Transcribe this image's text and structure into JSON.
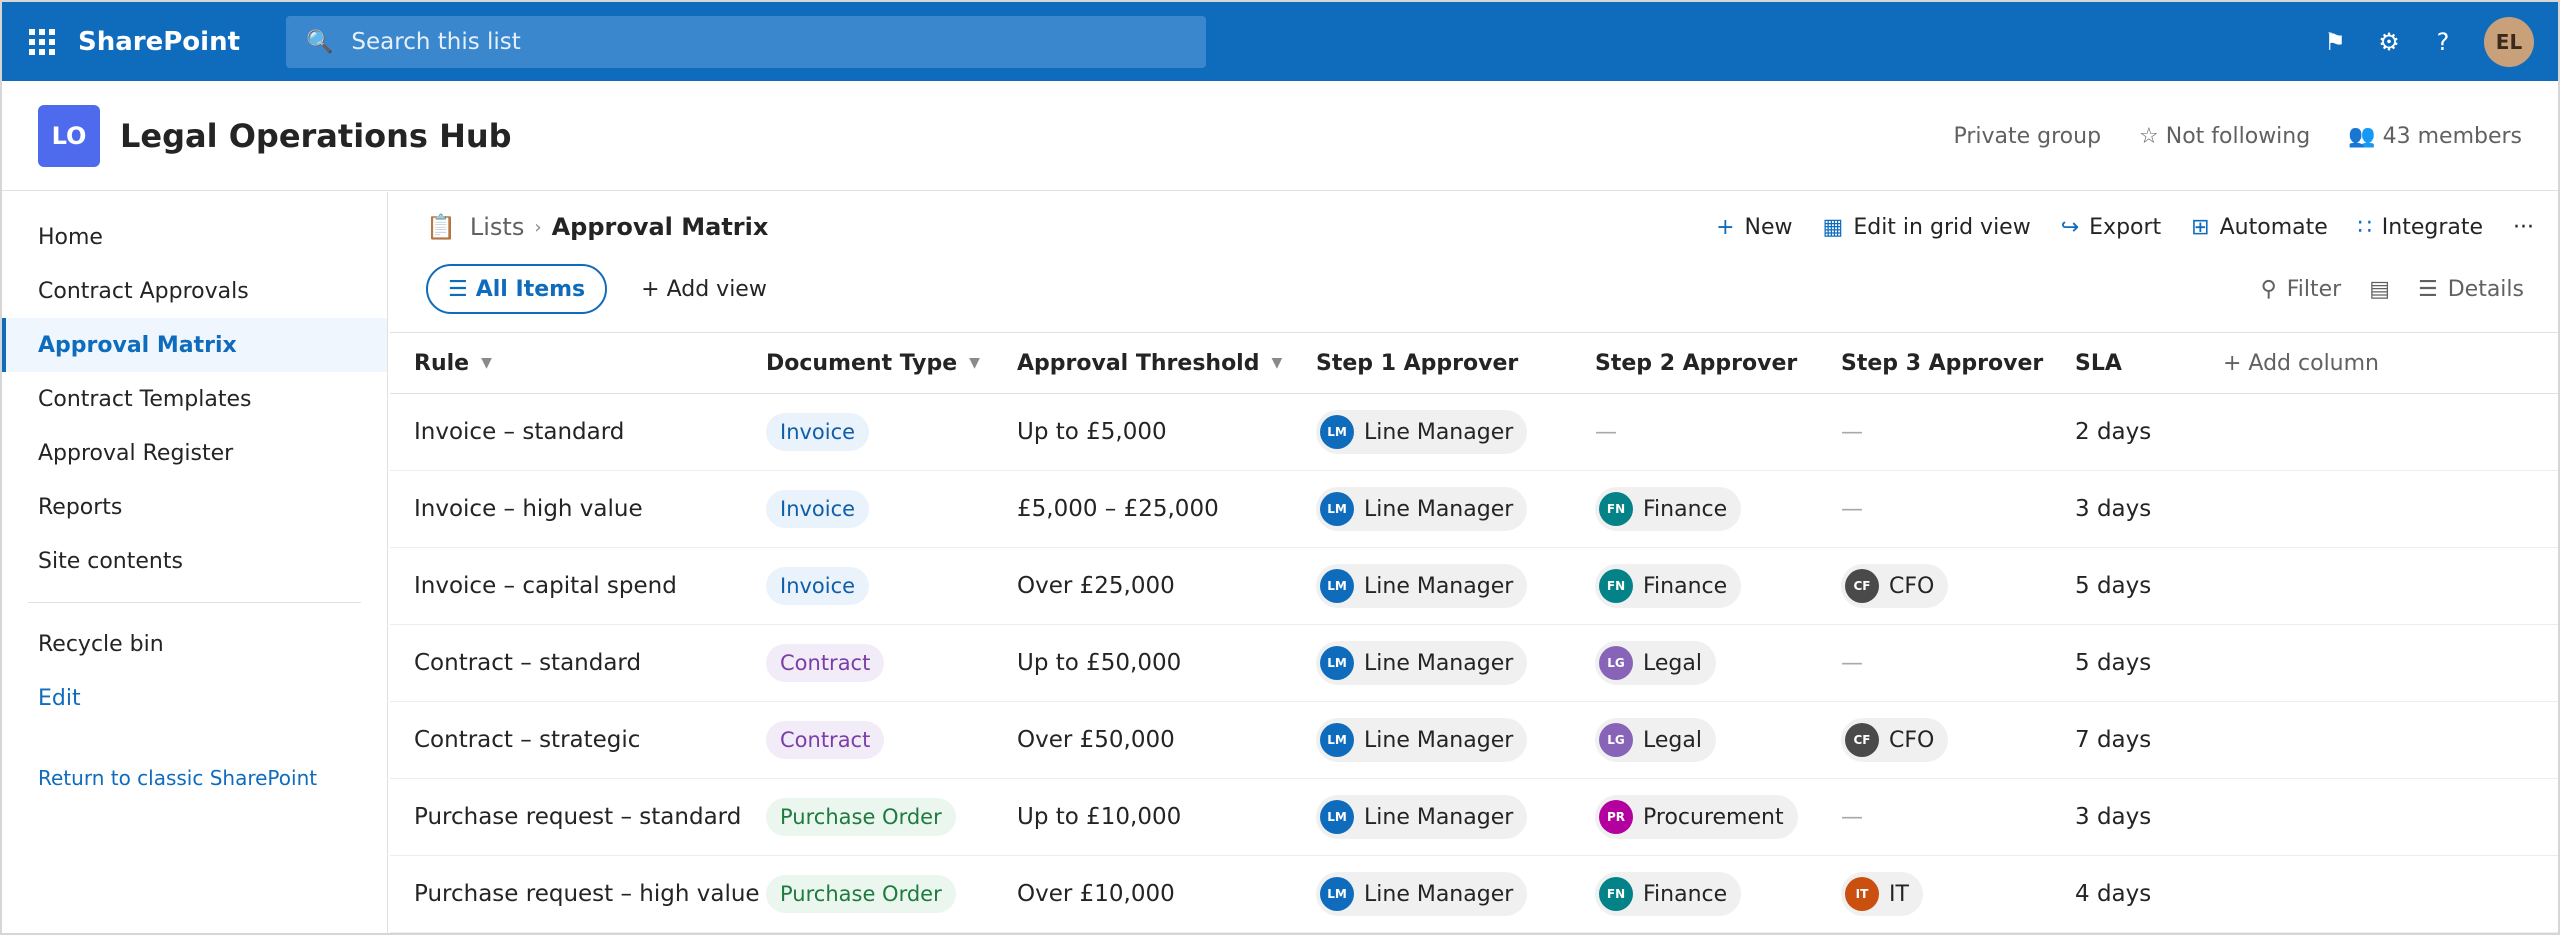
{
  "suite": {
    "app_name": "SharePoint",
    "search_placeholder": "Search this list",
    "icons": [
      "waffle-icon",
      "search-icon",
      "flag-icon",
      "settings-icon",
      "help-icon"
    ],
    "user_initials": "EL",
    "brand_color": "#0f6cbd"
  },
  "site": {
    "logo_initials": "LO",
    "title": "Legal Operations Hub",
    "privacy": "Private group",
    "follow": "☆ Not following",
    "members": "43 members"
  },
  "nav": {
    "items": [
      {
        "label": "Home"
      },
      {
        "label": "Contract Approvals"
      },
      {
        "label": "Approval Matrix",
        "active": true
      },
      {
        "label": "Contract Templates"
      },
      {
        "label": "Approval Register"
      },
      {
        "label": "Reports"
      },
      {
        "label": "Site contents"
      }
    ],
    "recycle_bin": "Recycle bin",
    "edit": "Edit",
    "classic": "Return to classic SharePoint"
  },
  "breadcrumb": {
    "root": "Lists",
    "separator": "›",
    "current": "Approval Matrix"
  },
  "commands": {
    "new": "New",
    "edit_grid": "Edit in grid view",
    "export": "Export",
    "automate": "Automate",
    "integrate": "Integrate",
    "more": "···"
  },
  "views": {
    "all_items": "All Items",
    "add_view": "+ Add view",
    "filter": "Filter",
    "details": "Details"
  },
  "table": {
    "headers": [
      "Rule",
      "Document Type",
      "Approval Threshold",
      "Step 1 Approver",
      "Step 2 Approver",
      "Step 3 Approver",
      "SLA",
      "+ Add column"
    ],
    "rows": [
      {
        "rule": "Invoice – standard",
        "doc_type": "Invoice",
        "threshold": "Up to £5,000",
        "step1": {
          "initials": "LM",
          "name": "Line Manager"
        },
        "step2": null,
        "step3": null,
        "sla": "2 days"
      },
      {
        "rule": "Invoice – high value",
        "doc_type": "Invoice",
        "threshold": "£5,000 – £25,000",
        "step1": {
          "initials": "LM",
          "name": "Line Manager"
        },
        "step2": {
          "initials": "FN",
          "name": "Finance"
        },
        "step3": null,
        "sla": "3 days"
      },
      {
        "rule": "Invoice – capital spend",
        "doc_type": "Invoice",
        "threshold": "Over £25,000",
        "step1": {
          "initials": "LM",
          "name": "Line Manager"
        },
        "step2": {
          "initials": "FN",
          "name": "Finance"
        },
        "step3": {
          "initials": "CF",
          "name": "CFO"
        },
        "sla": "5 days"
      },
      {
        "rule": "Contract – standard",
        "doc_type": "Contract",
        "threshold": "Up to £50,000",
        "step1": {
          "initials": "LM",
          "name": "Line Manager"
        },
        "step2": {
          "initials": "LG",
          "name": "Legal"
        },
        "step3": null,
        "sla": "5 days"
      },
      {
        "rule": "Contract – strategic",
        "doc_type": "Contract",
        "threshold": "Over £50,000",
        "step1": {
          "initials": "LM",
          "name": "Line Manager"
        },
        "step2": {
          "initials": "LG",
          "name": "Legal"
        },
        "step3": {
          "initials": "CF",
          "name": "CFO"
        },
        "sla": "7 days"
      },
      {
        "rule": "Purchase request – standard",
        "doc_type": "Purchase Order",
        "threshold": "Up to £10,000",
        "step1": {
          "initials": "LM",
          "name": "Line Manager"
        },
        "step2": {
          "initials": "PR",
          "name": "Procurement"
        },
        "step3": null,
        "sla": "3 days"
      },
      {
        "rule": "Purchase request – high value",
        "doc_type": "Purchase Order",
        "threshold": "Over £10,000",
        "step1": {
          "initials": "LM",
          "name": "Line Manager"
        },
        "step2": {
          "initials": "FN",
          "name": "Finance"
        },
        "step3": {
          "initials": "IT",
          "name": "IT"
        },
        "sla": "4 days"
      }
    ],
    "empty_marker": "—"
  },
  "colors": {
    "avatar": {
      "LM": "#0f6cbd",
      "FN": "#038387",
      "CF": "#4a4a4a",
      "LG": "#8764b8",
      "PR": "#b4009e",
      "IT": "#ca5010"
    },
    "doc_type": {
      "Invoice": "tag-invoice",
      "Contract": "tag-contract",
      "Purchase Order": "tag-po"
    }
  }
}
